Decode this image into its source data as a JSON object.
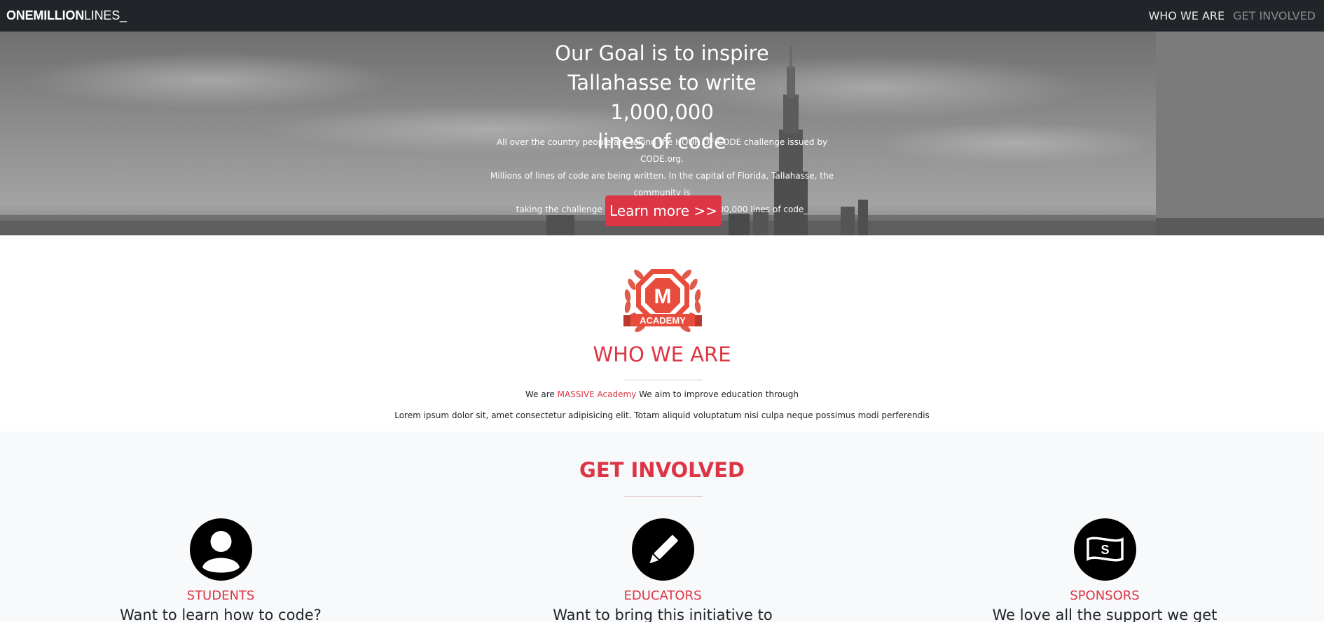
{
  "navbar": {
    "brand_bold": "ONEMILLION",
    "brand_light": "LINES_",
    "links": [
      {
        "label": "WHO WE ARE"
      },
      {
        "label": "GET INVOLVED"
      }
    ]
  },
  "hero": {
    "title_lines": [
      "Our Goal is to inspire",
      "Tallahasse to write 1,000,000",
      "lines of code"
    ],
    "text_lines": [
      "All over the country people are taking the HOUR OF CODE challenge issued by CODE.org.",
      "Millions of lines of code are being written. In the capital of Florida, Tallahasse, the community is",
      "taking the challenge and our goal is to write 1,000,000 lines of code_"
    ],
    "button_label": "Learn more >>"
  },
  "who": {
    "logo_letter": "M",
    "logo_banner": "ACADEMY",
    "title": "WHO WE ARE",
    "line1_prefix": "We are ",
    "line1_accent": "MASSIVE Academy",
    "line1_suffix": " We aim to improve education through",
    "line2": "Lorem ipsum dolor sit, amet consectetur adipisicing elit. Totam aliquid voluptatum nisi culpa neque possimus modi perferendis"
  },
  "involved": {
    "title": "GET INVOLVED",
    "cards": [
      {
        "icon": "person-icon",
        "title": "STUDENTS",
        "text": "Want to learn how to code?"
      },
      {
        "icon": "pencil-icon",
        "title": "EDUCATORS",
        "text": "Want to bring this initiative to"
      },
      {
        "icon": "money-icon",
        "title": "SPONSORS",
        "text": "We love all the support we get"
      }
    ]
  },
  "colors": {
    "accent": "#dc3545",
    "navbar_bg": "#212529",
    "section_bg": "#f8f9fa"
  }
}
